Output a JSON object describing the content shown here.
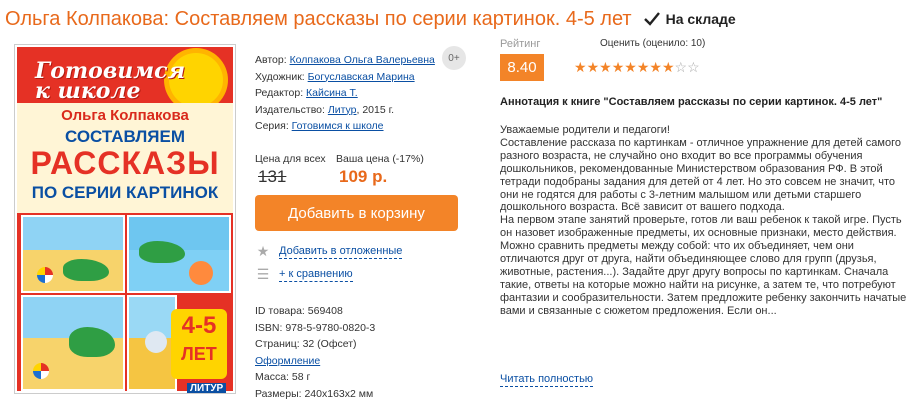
{
  "header": {
    "title": "Ольга Колпакова: Составляем рассказы по серии картинок. 4-5 лет",
    "stock_label": "На складе"
  },
  "cover": {
    "series_logo": "Готовимся к школе",
    "author": "Ольга Колпакова",
    "title_line1": "СОСТАВЛЯЕМ",
    "title_line2": "РАССКАЗЫ",
    "title_line3": "ПО СЕРИИ КАРТИНОК",
    "age_number": "4-5",
    "age_word": "ЛЕТ",
    "publisher_mark": "ЛИТУР"
  },
  "details": {
    "author_label": "Автор:",
    "author_value": "Колпакова Ольга Валерьевна",
    "illustrator_label": "Художник:",
    "illustrator_value": "Богуславская Марина",
    "editor_label": "Редактор:",
    "editor_value": "Кайсина Т.",
    "publisher_label": "Издательство:",
    "publisher_value": "Литур",
    "publisher_year": ", 2015 г.",
    "series_label": "Серия:",
    "series_value": "Готовимся к школе",
    "age_badge": "0+"
  },
  "price": {
    "all_label": "Цена для всех",
    "your_label": "Ваша цена (-17%)",
    "old": "131",
    "new": "109 р."
  },
  "actions": {
    "add_to_cart": "Добавить в корзину",
    "wishlist": "Добавить в отложенные",
    "compare": "+ к сравнению"
  },
  "specs": {
    "id": "ID товара: 569408",
    "isbn": "ISBN: 978-5-9780-0820-3",
    "pages": "Страниц: 32 (Офсет)",
    "design_link": "Оформление",
    "weight": "Масса: 58 г",
    "dims": "Размеры: 240x163x2 мм"
  },
  "rating": {
    "label": "Рейтинг",
    "value": "8.40",
    "rate_label": "Оценить (оценило: 10)",
    "stars_filled": 8,
    "stars_total": 10,
    "accent": "#f38428"
  },
  "annotation": {
    "title": "Аннотация к книге \"Составляем рассказы по серии картинок. 4-5 лет\"",
    "greeting": "Уважаемые родители и педагоги!",
    "body": "Составление рассказа по картинкам - отличное упражнение для детей самого разного возраста, не случайно оно входит во все программы обучения дошкольников, рекомендованные Министерством образования РФ. В этой тетради подобраны задания для детей от 4 лет. Но это совсем не значит, что они не годятся для работы с 3-летним малышом или детьми старшего дошкольного возраста. Всё зависит от вашего подхода.",
    "body2": "На первом этапе занятий проверьте, готов ли ваш ребенок к такой игре. Пусть он назовет изображенные предметы, их основные признаки, место действия. Можно сравнить предметы между собой: что их объединяет, чем они отличаются друг от друга, найти объединяющее слово для групп (друзья, животные, растения...). Задайте друг другу вопросы по картинкам. Сначала такие, ответы на которые можно найти на рисунке, а затем те, что потребуют фантазии и сообразительности. Затем предложите ребенку закончить начатые вами и связанные с сюжетом предложения. Если он...",
    "read_more": "Читать полностью"
  }
}
